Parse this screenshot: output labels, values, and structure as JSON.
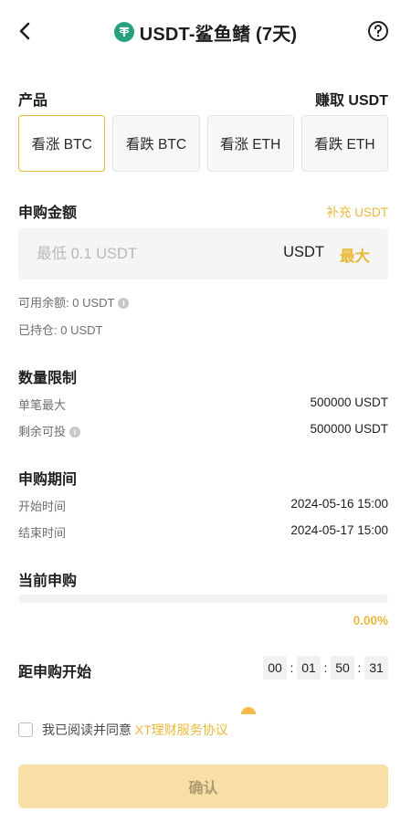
{
  "header": {
    "title": "USDT-鲨鱼鳍 (7天)",
    "back_icon": "chevron-left-icon",
    "help_icon": "question-circle-icon",
    "coin_icon": "usdt-icon",
    "coin_color": "#26a17b"
  },
  "product": {
    "label": "产品",
    "earn": "赚取 USDT",
    "options": [
      "看涨 BTC",
      "看跌 BTC",
      "看涨 ETH",
      "看跌 ETH"
    ],
    "selected_index": 0
  },
  "amount": {
    "label": "申购金额",
    "topup": "补充 USDT",
    "placeholder": "最低 0.1 USDT",
    "unit": "USDT",
    "max": "最大",
    "available_label": "可用余额: 0 USDT",
    "held_label": "已持仓: 0 USDT"
  },
  "limits": {
    "label": "数量限制",
    "single_max_label": "单笔最大",
    "single_max_value": "500000 USDT",
    "remaining_label": "剩余可投",
    "remaining_value": "500000 USDT"
  },
  "period": {
    "label": "申购期间",
    "start_label": "开始时间",
    "start_value": "2024-05-16 15:00",
    "end_label": "结束时间",
    "end_value": "2024-05-17 15:00"
  },
  "current": {
    "label": "当前申购",
    "progress_percent": 0,
    "progress_text": "0.00%"
  },
  "countdown": {
    "label": "距申购开始",
    "values": [
      "00",
      "01",
      "50",
      "31"
    ]
  },
  "agreement": {
    "prefix": "我已阅读并同意",
    "link": "XT理财服务协议",
    "checked": false
  },
  "confirm": {
    "label": "确认"
  },
  "colors": {
    "accent": "#e8b93c",
    "confirm_bg": "#f7dfa5"
  }
}
